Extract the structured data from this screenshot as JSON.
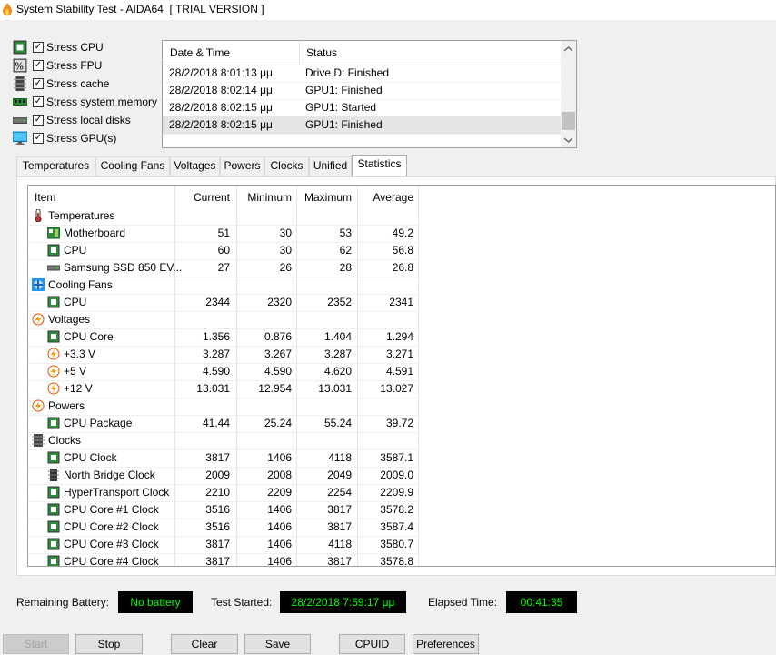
{
  "window": {
    "title": "System Stability Test - AIDA64  [ TRIAL VERSION ]"
  },
  "stress": [
    {
      "label": "Stress CPU",
      "checked": true,
      "icon": "cpu-chip-icon"
    },
    {
      "label": "Stress FPU",
      "checked": true,
      "icon": "fpu-icon"
    },
    {
      "label": "Stress cache",
      "checked": true,
      "icon": "cache-icon"
    },
    {
      "label": "Stress system memory",
      "checked": true,
      "icon": "memory-icon"
    },
    {
      "label": "Stress local disks",
      "checked": true,
      "icon": "disk-icon"
    },
    {
      "label": "Stress GPU(s)",
      "checked": true,
      "icon": "monitor-icon"
    }
  ],
  "log": {
    "columns": [
      "Date & Time",
      "Status"
    ],
    "rows": [
      {
        "time": "28/2/2018 8:01:13 μμ",
        "status": "Drive D: Finished"
      },
      {
        "time": "28/2/2018 8:02:14 μμ",
        "status": "GPU1: Finished"
      },
      {
        "time": "28/2/2018 8:02:15 μμ",
        "status": "GPU1: Started"
      },
      {
        "time": "28/2/2018 8:02:15 μμ",
        "status": "GPU1: Finished"
      }
    ]
  },
  "tabs": [
    "Temperatures",
    "Cooling Fans",
    "Voltages",
    "Powers",
    "Clocks",
    "Unified",
    "Statistics"
  ],
  "active_tab": "Statistics",
  "stats": {
    "columns": [
      "Item",
      "Current",
      "Minimum",
      "Maximum",
      "Average"
    ],
    "rows": [
      {
        "group": true,
        "name": "Temperatures",
        "icon": "thermometer-icon"
      },
      {
        "name": "Motherboard",
        "icon": "motherboard-icon",
        "current": "51",
        "min": "30",
        "max": "53",
        "avg": "49.2"
      },
      {
        "name": "CPU",
        "icon": "cpu-chip-icon",
        "current": "60",
        "min": "30",
        "max": "62",
        "avg": "56.8"
      },
      {
        "name": "Samsung SSD 850 EV...",
        "icon": "disk-icon",
        "current": "27",
        "min": "26",
        "max": "28",
        "avg": "26.8"
      },
      {
        "group": true,
        "name": "Cooling Fans",
        "icon": "fan-icon"
      },
      {
        "name": "CPU",
        "icon": "cpu-chip-icon",
        "current": "2344",
        "min": "2320",
        "max": "2352",
        "avg": "2341"
      },
      {
        "group": true,
        "name": "Voltages",
        "icon": "lightning-icon"
      },
      {
        "name": "CPU Core",
        "icon": "cpu-chip-icon",
        "current": "1.356",
        "min": "0.876",
        "max": "1.404",
        "avg": "1.294"
      },
      {
        "name": "+3.3 V",
        "icon": "lightning-icon",
        "current": "3.287",
        "min": "3.267",
        "max": "3.287",
        "avg": "3.271"
      },
      {
        "name": "+5 V",
        "icon": "lightning-icon",
        "current": "4.590",
        "min": "4.590",
        "max": "4.620",
        "avg": "4.591"
      },
      {
        "name": "+12 V",
        "icon": "lightning-icon",
        "current": "13.031",
        "min": "12.954",
        "max": "13.031",
        "avg": "13.027"
      },
      {
        "group": true,
        "name": "Powers",
        "icon": "lightning-icon"
      },
      {
        "name": "CPU Package",
        "icon": "cpu-chip-icon",
        "current": "41.44",
        "min": "25.24",
        "max": "55.24",
        "avg": "39.72"
      },
      {
        "group": true,
        "name": "Clocks",
        "icon": "clock-chip-icon"
      },
      {
        "name": "CPU Clock",
        "icon": "cpu-chip-icon",
        "current": "3817",
        "min": "1406",
        "max": "4118",
        "avg": "3587.1"
      },
      {
        "name": "North Bridge Clock",
        "icon": "chipset-icon",
        "current": "2009",
        "min": "2008",
        "max": "2049",
        "avg": "2009.0"
      },
      {
        "name": "HyperTransport Clock",
        "icon": "cpu-chip-icon",
        "current": "2210",
        "min": "2209",
        "max": "2254",
        "avg": "2209.9"
      },
      {
        "name": "CPU Core #1 Clock",
        "icon": "cpu-chip-icon",
        "current": "3516",
        "min": "1406",
        "max": "3817",
        "avg": "3578.2"
      },
      {
        "name": "CPU Core #2 Clock",
        "icon": "cpu-chip-icon",
        "current": "3516",
        "min": "1406",
        "max": "3817",
        "avg": "3587.4"
      },
      {
        "name": "CPU Core #3 Clock",
        "icon": "cpu-chip-icon",
        "current": "3817",
        "min": "1406",
        "max": "4118",
        "avg": "3580.7"
      },
      {
        "name": "CPU Core #4 Clock",
        "icon": "cpu-chip-icon",
        "current": "3817",
        "min": "1406",
        "max": "3817",
        "avg": "3578.8"
      }
    ]
  },
  "status_bar": {
    "battery_label": "Remaining Battery:",
    "battery_value": "No battery",
    "started_label": "Test Started:",
    "started_value": "28/2/2018 7:59:17 μμ",
    "elapsed_label": "Elapsed Time:",
    "elapsed_value": "00:41:35"
  },
  "buttons": {
    "start": "Start",
    "stop": "Stop",
    "clear": "Clear",
    "save": "Save",
    "cpuid": "CPUID",
    "preferences": "Preferences"
  },
  "colors": {
    "lcd_bg": "#000000",
    "lcd_text": "#00ff00",
    "selection": "#e5e5e5"
  }
}
